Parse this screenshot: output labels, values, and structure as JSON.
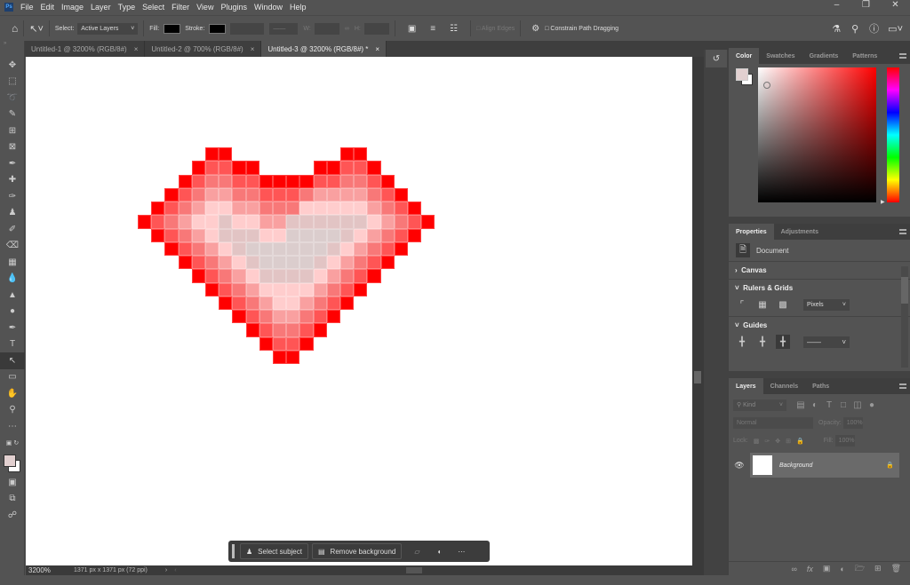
{
  "app": {
    "logo": "Ps",
    "menu": [
      "File",
      "Edit",
      "Image",
      "Layer",
      "Type",
      "Select",
      "Filter",
      "View",
      "Plugins",
      "Window",
      "Help"
    ]
  },
  "options": {
    "select_label": "Select:",
    "select_value": "Active Layers",
    "fill_label": "Fill:",
    "stroke_label": "Stroke:",
    "w_label": "W:",
    "h_label": "H:",
    "align_edges": "Align Edges",
    "constrain": "Constrain Path Dragging"
  },
  "tabs": [
    {
      "label": "Untitled-1 @ 3200% (RGB/8#)"
    },
    {
      "label": "Untitled-2 @ 700% (RGB/8#)"
    },
    {
      "label": "Untitled-3 @ 3200% (RGB/8#) *"
    }
  ],
  "status": {
    "zoom": "3200%",
    "doc_info": "1371 px x 1371 px (72 ppi)"
  },
  "contextbar": {
    "select_subject": "Select subject",
    "remove_background": "Remove background"
  },
  "color_panel": {
    "tabs": [
      "Color",
      "Swatches",
      "Gradients",
      "Patterns"
    ],
    "foreground": "#e2d0d0",
    "background": "#ffffff",
    "hue": "#ff0000"
  },
  "properties": {
    "tabs": [
      "Properties",
      "Adjustments"
    ],
    "doc_label": "Document",
    "canvas": "Canvas",
    "rulers": "Rulers & Grids",
    "units": "Pixels",
    "guides": "Guides"
  },
  "layers": {
    "tabs": [
      "Layers",
      "Channels",
      "Paths"
    ],
    "kind": "Kind",
    "blend": "Normal",
    "opacity_label": "Opacity:",
    "opacity": "100%",
    "lock_label": "Lock:",
    "fill_label": "Fill:",
    "fill": "100%",
    "items": [
      {
        "name": "Background"
      }
    ]
  },
  "heart": {
    "palette": {
      "R": "#ff0000",
      "1": "#ff5555",
      "2": "#f87878",
      "3": "#f9a0a0",
      "4": "#ffcdcd",
      "5": "#e2c4c4",
      "6": "#dbcdcd"
    },
    "rows": [
      ".....RR........RR.....",
      "....R11RR....RR11R....",
      "...R12211RRRR11221R...",
      "..R1233221112333321R..",
      ".R123443322244444321R.",
      "R12344544335555554321R",
      ".R123455544666654321R.",
      "..R1234566666654321R..",
      "...R12345666654321R...",
      "....R123455554321R....",
      ".....R1234444321R.....",
      "......R12344321R......",
      ".......R123321R.......",
      "........R1221R........",
      ".........R11R.........",
      "..........RR.........."
    ]
  }
}
